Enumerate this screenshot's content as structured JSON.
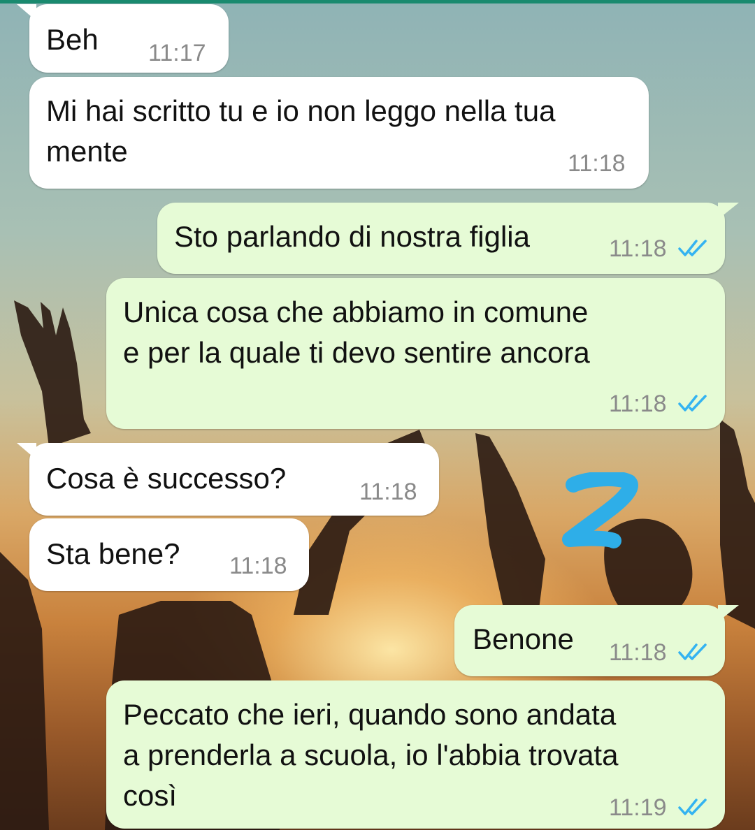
{
  "colors": {
    "incoming_bubble": "#ffffff",
    "outgoing_bubble": "#e6fbd6",
    "read_ticks": "#34b3f1",
    "annotation": "#2eaee8",
    "top_bar": "#1a8a6f"
  },
  "messages": [
    {
      "direction": "incoming",
      "text": "Beh",
      "time": "11:17"
    },
    {
      "direction": "incoming",
      "text_lines": [
        "Mi hai scritto tu e io non leggo nella tua",
        "mente"
      ],
      "time": "11:18"
    },
    {
      "direction": "outgoing",
      "text": "Sto parlando di nostra figlia",
      "time": "11:18",
      "status_icon": "double-check-read-icon"
    },
    {
      "direction": "outgoing",
      "text_lines": [
        "Unica cosa che abbiamo in comune",
        "e per la quale ti devo sentire ancora"
      ],
      "time": "11:18",
      "status_icon": "double-check-read-icon"
    },
    {
      "direction": "incoming",
      "text": "Cosa è successo?",
      "time": "11:18"
    },
    {
      "direction": "incoming",
      "text": "Sta bene?",
      "time": "11:18"
    },
    {
      "direction": "outgoing",
      "text": "Benone",
      "time": "11:18",
      "status_icon": "double-check-read-icon"
    },
    {
      "direction": "outgoing",
      "text_lines": [
        "Peccato che ieri, quando sono andata",
        "a prenderla a scuola, io l'abbia trovata",
        "così"
      ],
      "time": "11:19",
      "status_icon": "double-check-read-icon"
    }
  ],
  "annotation": {
    "text": "2",
    "icon": "handwritten-number-two-icon"
  }
}
